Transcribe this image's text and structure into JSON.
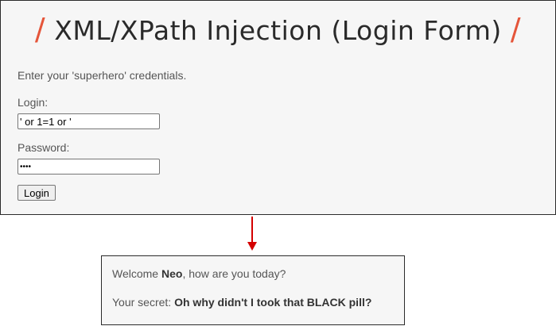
{
  "form": {
    "title": "XML/XPath Injection (Login Form)",
    "title_deco": "/",
    "intro": "Enter your 'superhero' credentials.",
    "login_label": "Login:",
    "login_value": "' or 1=1 or '",
    "password_label": "Password:",
    "password_value": "••••",
    "submit_label": "Login"
  },
  "arrow": {
    "color": "#d40000"
  },
  "result": {
    "welcome_prefix": "Welcome ",
    "user_name": "Neo",
    "welcome_suffix": ", how are you today?",
    "secret_prefix": "Your secret: ",
    "secret_value": "Oh why didn't I took that BLACK pill?"
  },
  "colors": {
    "accent": "#e5553a",
    "panel_bg": "#f6f6f6",
    "text": "#555555"
  }
}
